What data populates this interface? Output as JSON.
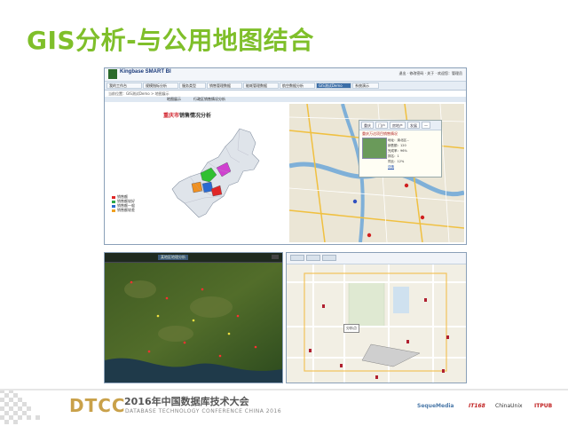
{
  "slide": {
    "title": "GIS分析-与公用地图结合"
  },
  "window1": {
    "brand": "Kingbase SMART BI",
    "top_links": "退出 · 修改密码 · 关于 · 欢迎您：管理员",
    "tabs": [
      "我的工作台",
      "规模指标分析",
      "服务类型",
      "销售管理数据",
      "能耗管理数据",
      "航空数据分析",
      "GIS测试Demo",
      "系统演示"
    ],
    "active_tab": "GIS测试Demo",
    "breadcrumb": "当前位置：GIS测试Demo > 地图展示",
    "subtabs": [
      "地图展示",
      "行政区销售情况分析"
    ],
    "map_title_red": "重庆市",
    "map_title_rest": "销售情况分析",
    "legend": [
      "销售额",
      "销售额较好",
      "销售额一般",
      "销售额较差"
    ],
    "legend_colors": [
      "#e02626",
      "#2aa84a",
      "#2a6ad0",
      "#f0a020"
    ],
    "popup": {
      "tabs": [
        "重庆",
        "门户",
        "房地产",
        "发展",
        "一"
      ],
      "heading": "重庆万达项目销售情况",
      "rows": [
        "地址：渝北区...",
        "销售额：120",
        "完成率：96%",
        "排名：1",
        "同比：12%",
        "详情"
      ]
    },
    "highlight_colors": [
      "#d040d0",
      "#30c030",
      "#f09020"
    ]
  },
  "window2": {
    "title": "某地区地理分析"
  },
  "window3": {
    "info_label": "分析点"
  },
  "footer": {
    "logo": "DTCC",
    "title_cn": "2016年中国数据库技术大会",
    "subtitle": "DATABASE TECHNOLOGY CONFERENCE CHINA 2016",
    "sponsors": [
      "SequeMedia",
      "IT168",
      "ChinaUnix",
      "ITPUB"
    ]
  }
}
